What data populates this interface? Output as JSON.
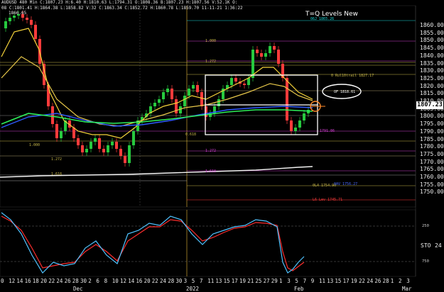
{
  "header": {
    "line1": "AUDUSD 480 Min  C:1807.23  H:6.40  H:1810.63  L:1794.31  O:1808.36  B:1807.23  H:1807.56  V:52.1K  O:",
    "line2": "08  C:1801.41  H:1864.38  L:1858.82  V:32  C:1863.34  C:1852.72  H:1860.78  L:1859.70  11-11-21  1:36:22",
    "line3": "1866.65"
  },
  "panel_title": "T=Q Levels New",
  "price_axis": {
    "labels": [
      "1860.00",
      "1855.00",
      "1850.00",
      "1845.00",
      "1840.00",
      "1835.00",
      "1830.00",
      "1825.00",
      "1820.00",
      "1815.00",
      "1810.00",
      "1805.00",
      "1800.00",
      "1795.00",
      "1790.00",
      "1785.00",
      "1780.00",
      "1775.00",
      "1770.00",
      "1765.00",
      "1760.00",
      "1755.00",
      "1750.00"
    ],
    "current_price": "1807.23"
  },
  "time_axis": {
    "day_labels": [
      "0",
      "12",
      "14",
      "16",
      "18",
      "20",
      "22",
      "24",
      "26",
      "28",
      "30",
      "2",
      "6",
      "8",
      "10",
      "12",
      "14",
      "16",
      "20",
      "22",
      "24",
      "28",
      "30",
      "3",
      "5",
      "7",
      "11",
      "13",
      "15",
      "17",
      "19",
      "21",
      "25",
      "27",
      "29",
      "1",
      "3",
      "5",
      "7",
      "9",
      "11",
      "13",
      "15",
      "17",
      "19",
      "22",
      "24",
      "26",
      "28",
      "1",
      "2",
      "3"
    ],
    "month_labels": [
      "Dec",
      "2022",
      "Feb",
      "Mar"
    ]
  },
  "level_tags": {
    "top": "06J  1865.26",
    "q1": "1.000",
    "q2": "1.272",
    "q3": "1.618",
    "mid": "0  Rul10trail  1827.17",
    "of": "OF  1818.61",
    "box_low": "1791.86",
    "left1": "0.618",
    "left2": "1.000",
    "left3": "1.272",
    "left4": "1.618",
    "low1": "1.272",
    "low2": "1.618",
    "bl1": "0L4  1754.90",
    "bl2": "0AV  1756.27",
    "bl3": "L6  Lev  1745.71",
    "b1": "0.00",
    "b2": "0.00"
  },
  "oscillator": {
    "name": "STO",
    "period": "24",
    "level_high": "250",
    "level_low": "750"
  },
  "colors": {
    "bull": "#27c93f",
    "bear": "#ff3b3b",
    "ma_yellow": "#f5d33a",
    "ma_blue": "#2f5bff",
    "ma_green": "#2ef05a",
    "ma_white": "#f2f2f2",
    "stoch_cyan": "#4fc3ff",
    "stoch_red": "#ff2d2d",
    "cyan_line": "#18d6d6",
    "magenta": "#d23fd2"
  }
}
